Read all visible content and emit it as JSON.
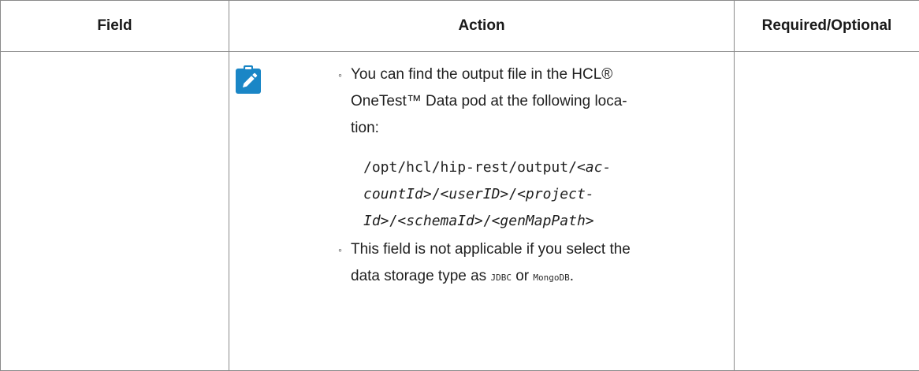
{
  "table": {
    "headers": {
      "field": "Field",
      "action": "Action",
      "required": "Required/Optional"
    },
    "row": {
      "field": "",
      "required": "",
      "note_icon": "pencil-note-icon",
      "note": {
        "bullet1_line1": "You can find the output file in the HCL®",
        "bullet1_line2": "OneTest™ Data pod at the following loca-",
        "bullet1_line3": "tion:",
        "path": {
          "p1_plain": "/opt/hcl/hip-rest/output/",
          "p1_var": "<ac-",
          "p2_var1": "countId>",
          "p2_sep1": "/",
          "p2_var2": "<userID>",
          "p2_sep2": "/",
          "p2_var3": "<project-",
          "p3_var1": "Id>",
          "p3_sep1": "/",
          "p3_var2": "<schemaId>",
          "p3_sep2": "/",
          "p3_var3": "<genMapPath>"
        },
        "bullet2_line1": "This field is not applicable if you select the",
        "bullet2_line2_pre": "data storage type as ",
        "bullet2_code1": "JDBC",
        "bullet2_or": " or ",
        "bullet2_code2": "MongoDB",
        "bullet2_end": "."
      }
    }
  },
  "colors": {
    "icon_bg": "#1a86c6",
    "border": "#8a8a8a"
  }
}
